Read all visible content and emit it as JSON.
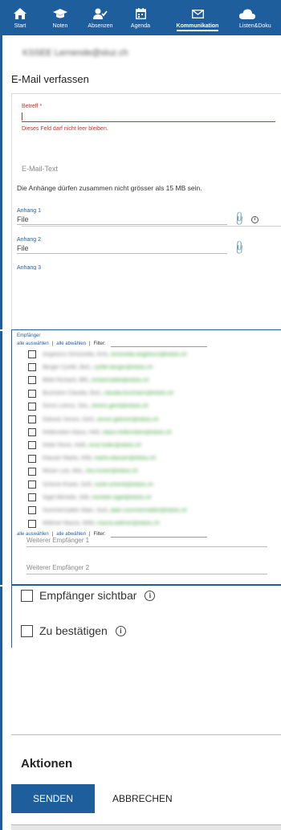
{
  "nav": {
    "items": [
      {
        "label": "Start",
        "icon": "home-icon"
      },
      {
        "label": "Noten",
        "icon": "graduation-cap-icon"
      },
      {
        "label": "Absenzen",
        "icon": "user-check-icon"
      },
      {
        "label": "Agenda",
        "icon": "calendar-icon"
      },
      {
        "label": "Kommunikation",
        "icon": "mail-icon",
        "active": true
      },
      {
        "label": "Listen&Doku",
        "icon": "cloud-icon"
      }
    ],
    "bar_color": "#1f5e9c"
  },
  "compose": {
    "account": "KSSEE Lernende@sluz.ch",
    "title": "E-Mail verfassen",
    "subject_label": "Betreff *",
    "subject_value": "",
    "subject_error": "Dieses Feld darf nicht leer bleiben.",
    "body_placeholder": "E-Mail-Text",
    "attachment_note": "Die Anhänge dürfen zusammen nicht grösser als 15 MB sein.",
    "attachments": [
      {
        "label": "Anhang 1",
        "value": "File"
      },
      {
        "label": "Anhang 2",
        "value": "File"
      },
      {
        "label": "Anhang 3",
        "value": ""
      }
    ],
    "error_color": "#d32f2f"
  },
  "recipients": {
    "heading": "Empfänger",
    "select_all": "alle auswählen",
    "deselect_all": "alle abwählen",
    "separator": "|",
    "filter_label": "Filter:",
    "list": [
      {
        "name": "Angelucci Simonetta, AnS",
        "email": "simonetta.angelucci@edulu.ch"
      },
      {
        "name": "Berger Cyrille, BeC",
        "email": "cyrille.berger@edulu.ch"
      },
      {
        "name": "Bittel Richard, BRi",
        "email": "richard.bittel@edulu.ch"
      },
      {
        "name": "Busmann Claudia, BuC",
        "email": "claudia.busmann@edulu.ch"
      },
      {
        "name": "Gerst Lorenz, GeL",
        "email": "lorenz.gerst@edulu.ch"
      },
      {
        "name": "Gelsser Simon, GeS",
        "email": "simon.gelsser@edulu.ch"
      },
      {
        "name": "Hellenstein Klaus, HeK",
        "email": "klaus.hellenstein@edulu.ch"
      },
      {
        "name": "Hofer René, HoR",
        "email": "rene.hofer@edulu.ch"
      },
      {
        "name": "Klauser Marlis, KlM",
        "email": "marlis.klauser@edulu.ch"
      },
      {
        "name": "Moser Lea, MoL",
        "email": "lea.moser@edulu.ch"
      },
      {
        "name": "Schenk Ruedi, ScR",
        "email": "ruedi.schenk@edulu.ch"
      },
      {
        "name": "Sigel Michèle, SiM",
        "email": "michele.sigel@edulu.ch"
      },
      {
        "name": "Summermatter Alain, SuA",
        "email": "alain.summermatter@edulu.ch"
      },
      {
        "name": "Wittmer Maura, WiM",
        "email": "maura.wittmer@edulu.ch"
      }
    ],
    "extra_1": "Weiterer Empfänger 1",
    "extra_2": "Weiterer Empfänger 2"
  },
  "options": {
    "visible_label": "Empfänger sichtbar",
    "confirm_label": "Zu bestätigen"
  },
  "actions": {
    "heading": "Aktionen",
    "send": "SENDEN",
    "cancel": "ABBRECHEN"
  }
}
